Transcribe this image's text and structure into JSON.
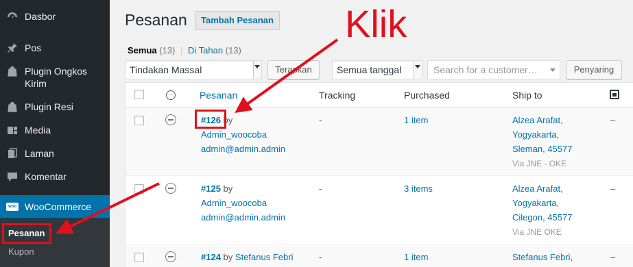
{
  "sidebar": {
    "items": [
      {
        "label": "Dasbor",
        "icon": "dashboard-icon"
      },
      {
        "label": "Pos",
        "icon": "pin-icon"
      },
      {
        "label": "Plugin Ongkos Kirim",
        "icon": "bag-icon"
      },
      {
        "label": "Plugin Resi",
        "icon": "bag-icon"
      },
      {
        "label": "Media",
        "icon": "media-icon"
      },
      {
        "label": "Laman",
        "icon": "pages-icon"
      },
      {
        "label": "Komentar",
        "icon": "comment-icon"
      },
      {
        "label": "WooCommerce",
        "icon": "woo-icon"
      }
    ],
    "woo_badge": "woo",
    "submenu": {
      "pesanan": "Pesanan",
      "kupon": "Kupon"
    }
  },
  "page": {
    "title": "Pesanan",
    "add_button": "Tambah Pesanan",
    "annotation": "Klik"
  },
  "filters": {
    "semua": "Semua",
    "semua_count": "(13)",
    "separator": "|",
    "ditahan": "Di Tahan",
    "ditahan_count": "(13)"
  },
  "toolbar": {
    "bulk_action": "Tindakan Massal",
    "apply": "Terapkan",
    "date_filter": "Semua tanggal",
    "search_placeholder": "Search for a customer…",
    "filter_button": "Penyaring"
  },
  "table": {
    "headers": {
      "order": "Pesanan",
      "tracking": "Tracking",
      "purchased": "Purchased",
      "ship_to": "Ship to"
    },
    "rows": [
      {
        "order": "#126",
        "by": "by",
        "customer": "Admin_woocoba",
        "email": "admin@admin.admin",
        "tracking": "-",
        "purchased": "1 item",
        "ship": [
          "Alzea Arafat,",
          "Yogyakarta,",
          "Sleman, 45577"
        ],
        "via": "Via JNE - OKE",
        "last": "–"
      },
      {
        "order": "#125",
        "by": "by",
        "customer": "Admin_woocoba",
        "email": "admin@admin.admin",
        "tracking": "-",
        "purchased": "3 items",
        "ship": [
          "Alzea Arafat,",
          "Yogyakarta,",
          "Cilegon, 45577"
        ],
        "via": "Via JNE OKE",
        "last": "–"
      },
      {
        "order": "#124",
        "by": "by",
        "customer": "Stefanus Febri",
        "email": "",
        "tracking": "-",
        "purchased": "1 item",
        "ship": [
          "Stefanus Febri,"
        ],
        "via": "",
        "last": "–"
      }
    ]
  },
  "colors": {
    "accent": "#0073aa",
    "annotation": "#e1101c",
    "sidebar_bg": "#23282d"
  }
}
